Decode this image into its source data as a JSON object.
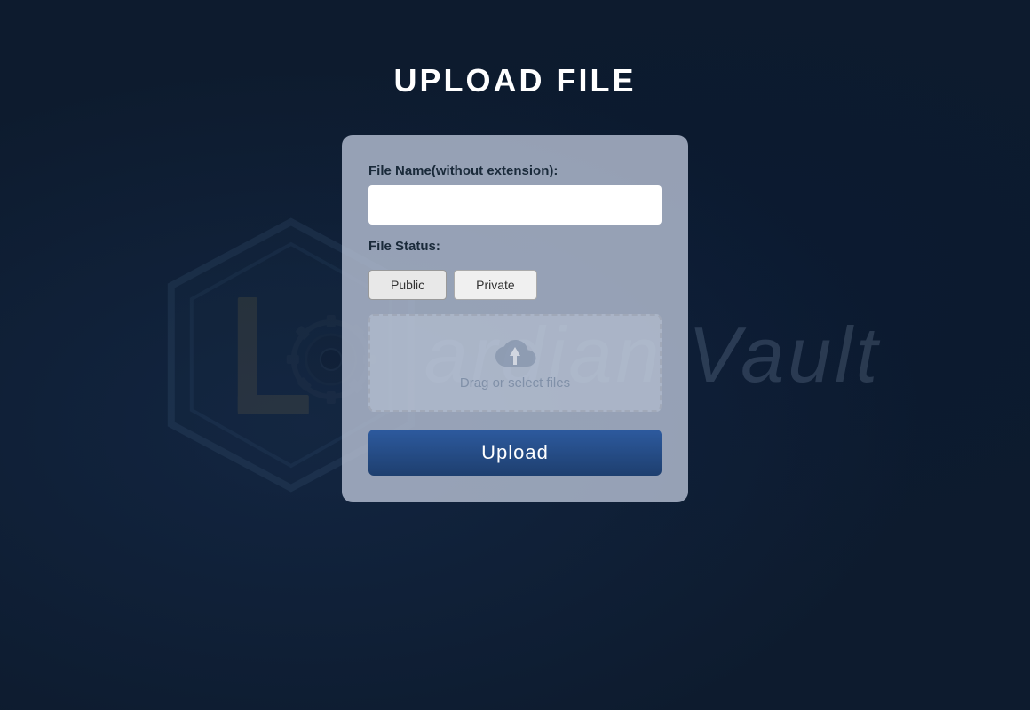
{
  "page": {
    "title": "UPLOAD FILE",
    "background_brand": "Guardian Vault"
  },
  "form": {
    "file_name_label": "File Name(without extension):",
    "file_name_placeholder": "",
    "file_status_label": "File Status:",
    "status_options": [
      {
        "id": "public",
        "label": "Public",
        "active": true
      },
      {
        "id": "private",
        "label": "Private",
        "active": false
      }
    ],
    "drop_zone_text": "Drag or select files",
    "upload_button_label": "Upload"
  }
}
